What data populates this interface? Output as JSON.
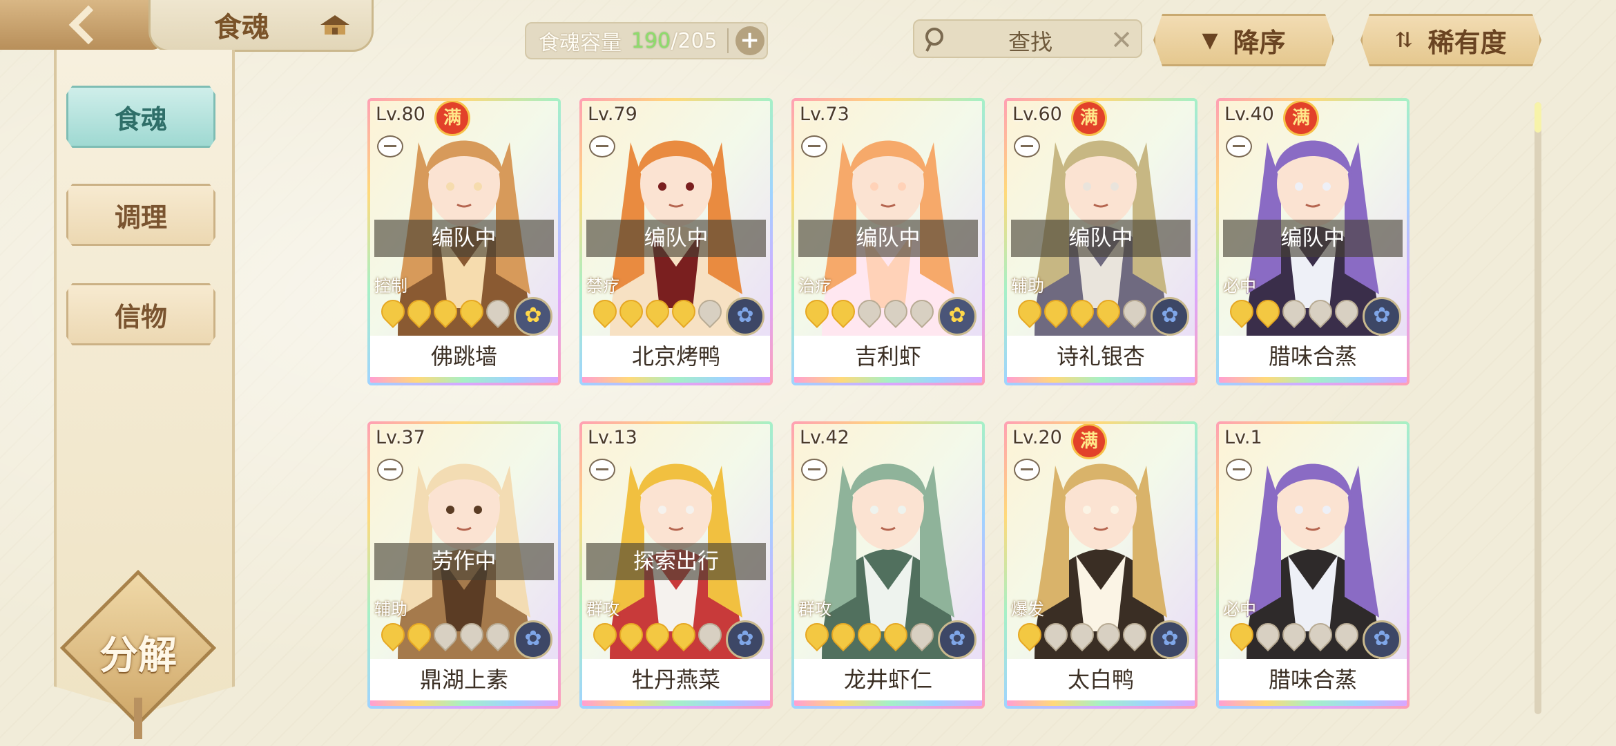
{
  "header": {
    "title": "食魂",
    "capacity_label": "食魂容量",
    "capacity_current": "190",
    "capacity_max": "/205",
    "capacity_add": "+",
    "search_placeholder": "查找",
    "search_clear": "✕",
    "sort_order": "降序",
    "sort_key": "稀有度"
  },
  "sidebar": {
    "tabs": [
      {
        "label": "食魂",
        "active": true
      },
      {
        "label": "调理",
        "active": false
      },
      {
        "label": "信物",
        "active": false
      }
    ],
    "decompose_label": "分解"
  },
  "cards": [
    {
      "level": "Lv.80",
      "full": "满",
      "status": "编队中",
      "role": "控制",
      "stars": 4,
      "name": "佛跳墙",
      "element_icon": "flower-yellow-icon",
      "art_colors": [
        "#f6dcae",
        "#d79a5a",
        "#8a5a32"
      ]
    },
    {
      "level": "Lv.79",
      "full": "",
      "status": "编队中",
      "role": "禁疗",
      "stars": 4,
      "name": "北京烤鸭",
      "element_icon": "flower-blue-icon",
      "art_colors": [
        "#7a1f1f",
        "#e98b40",
        "#f7e1c3"
      ]
    },
    {
      "level": "Lv.73",
      "full": "",
      "status": "编队中",
      "role": "治疗",
      "stars": 2,
      "name": "吉利虾",
      "element_icon": "flower-yellow-icon",
      "art_colors": [
        "#ffd2b8",
        "#f6a96a",
        "#ffe7f0"
      ]
    },
    {
      "level": "Lv.60",
      "full": "满",
      "status": "编队中",
      "role": "辅助",
      "stars": 4,
      "name": "诗礼银杏",
      "element_icon": "flower-blue-icon",
      "art_colors": [
        "#e9e4dc",
        "#c7b783",
        "#6f6a80"
      ]
    },
    {
      "level": "Lv.40",
      "full": "满",
      "status": "编队中",
      "role": "必中",
      "stars": 2,
      "name": "腊味合蒸",
      "element_icon": "flower-blue-icon",
      "art_colors": [
        "#eef0f7",
        "#8a6bc4",
        "#3a2e4a"
      ]
    },
    {
      "level": "Lv.37",
      "full": "",
      "status": "劳作中",
      "role": "辅助",
      "stars": 2,
      "name": "鼎湖上素",
      "element_icon": "flower-blue-icon",
      "art_colors": [
        "#5b3c24",
        "#f3dcb3",
        "#a57a4c"
      ]
    },
    {
      "level": "Lv.13",
      "full": "",
      "status": "探索出行",
      "role": "群攻",
      "stars": 4,
      "name": "牡丹燕菜",
      "element_icon": "flower-blue-icon",
      "art_colors": [
        "#f5f2ee",
        "#f1c040",
        "#c83a3a"
      ]
    },
    {
      "level": "Lv.42",
      "full": "",
      "status": "",
      "role": "群攻",
      "stars": 4,
      "name": "龙井虾仁",
      "element_icon": "flower-blue-icon",
      "art_colors": [
        "#eef3ee",
        "#8fb39a",
        "#51705e"
      ]
    },
    {
      "level": "Lv.20",
      "full": "满",
      "status": "",
      "role": "爆发",
      "stars": 1,
      "name": "太白鸭",
      "element_icon": "flower-blue-icon",
      "art_colors": [
        "#fbf4e5",
        "#d9b36a",
        "#3a2e24"
      ]
    },
    {
      "level": "Lv.1",
      "full": "",
      "status": "",
      "role": "必中",
      "stars": 1,
      "name": "腊味合蒸",
      "element_icon": "flower-blue-icon",
      "art_colors": [
        "#eef0f7",
        "#8a6bc4",
        "#2e2a2a"
      ]
    }
  ],
  "colors": {
    "accent_teal": "#9fd9d2",
    "gold": "#cfa768",
    "capacity_green": "#8fdc6c"
  }
}
